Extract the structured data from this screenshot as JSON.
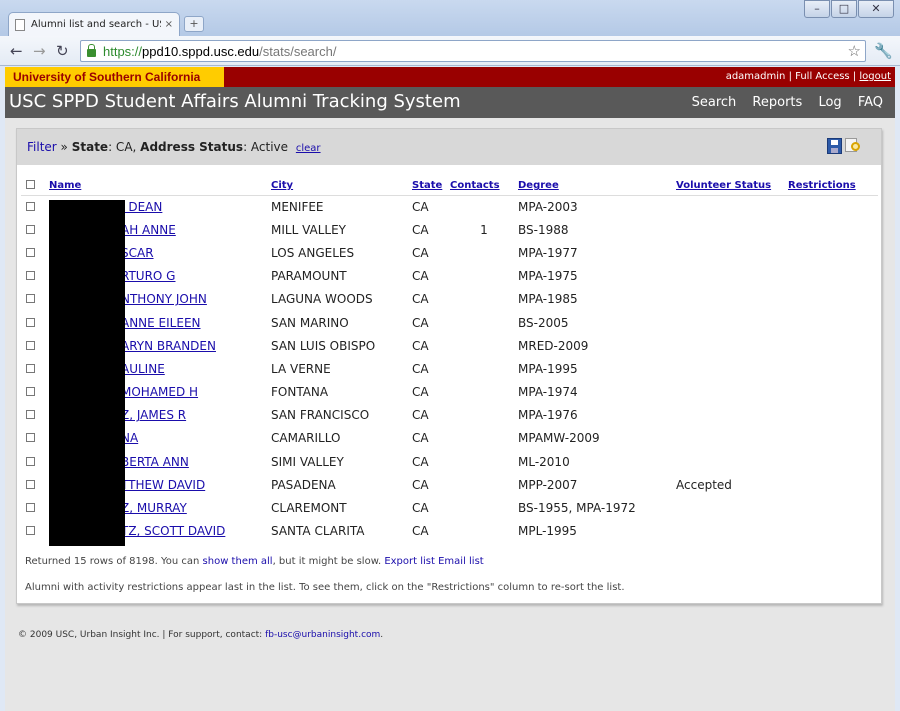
{
  "browser": {
    "tab_title": "Alumni list and search - US...",
    "tab_close": "×",
    "newtab": "+",
    "url_scheme": "https://",
    "url_host": "ppd10.sppd.usc.edu",
    "url_path": "/stats/search/",
    "back": "←",
    "forward": "→",
    "reload": "↻",
    "star": "☆",
    "wrench": "🔧",
    "minimize": "–",
    "maximize": "□",
    "close": "✕"
  },
  "header": {
    "university": "University of Southern California",
    "username": "adamadmin",
    "access": "Full Access",
    "logout": "logout",
    "sep": " | ",
    "site_title": "USC SPPD Student Affairs Alumni Tracking System",
    "nav": [
      "Search",
      "Reports",
      "Log",
      "FAQ"
    ]
  },
  "filter": {
    "filter_link": "Filter",
    "arrow": "»",
    "state_label": "State",
    "state_value": ": CA,",
    "address_label": "Address Status",
    "address_value": ": Active",
    "clear": "clear"
  },
  "table": {
    "columns": [
      "Name",
      "City",
      "State",
      "Contacts",
      "Degree",
      "Volunteer Status",
      "Restrictions"
    ],
    "rows": [
      {
        "name": "J DEAN",
        "city": "MENIFEE",
        "state": "CA",
        "contacts": "",
        "degree": "MPA-2003",
        "volunteer": "",
        "restrictions": ""
      },
      {
        "name": "AH ANNE",
        "city": "MILL VALLEY",
        "state": "CA",
        "contacts": "1",
        "degree": "BS-1988",
        "volunteer": "",
        "restrictions": ""
      },
      {
        "name": "SCAR",
        "city": "LOS ANGELES",
        "state": "CA",
        "contacts": "",
        "degree": "MPA-1977",
        "volunteer": "",
        "restrictions": ""
      },
      {
        "name": "RTURO G",
        "city": "PARAMOUNT",
        "state": "CA",
        "contacts": "",
        "degree": "MPA-1975",
        "volunteer": "",
        "restrictions": ""
      },
      {
        "name": "NTHONY JOHN",
        "city": "LAGUNA WOODS",
        "state": "CA",
        "contacts": "",
        "degree": "MPA-1985",
        "volunteer": "",
        "restrictions": ""
      },
      {
        "name": "ANNE EILEEN",
        "city": "SAN MARINO",
        "state": "CA",
        "contacts": "",
        "degree": "BS-2005",
        "volunteer": "",
        "restrictions": ""
      },
      {
        "name": "ARYN BRANDEN",
        "city": "SAN LUIS OBISPO",
        "state": "CA",
        "contacts": "",
        "degree": "MRED-2009",
        "volunteer": "",
        "restrictions": ""
      },
      {
        "name": "AULINE",
        "city": "LA VERNE",
        "state": "CA",
        "contacts": "",
        "degree": "MPA-1995",
        "volunteer": "",
        "restrictions": ""
      },
      {
        "name": "MOHAMED H",
        "city": "FONTANA",
        "state": "CA",
        "contacts": "",
        "degree": "MPA-1974",
        "volunteer": "",
        "restrictions": ""
      },
      {
        "name": "Z, JAMES R",
        "city": "SAN FRANCISCO",
        "state": "CA",
        "contacts": "",
        "degree": "MPA-1976",
        "volunteer": "",
        "restrictions": ""
      },
      {
        "name": "NA",
        "city": "CAMARILLO",
        "state": "CA",
        "contacts": "",
        "degree": "MPAMW-2009",
        "volunteer": "",
        "restrictions": ""
      },
      {
        "name": "BERTA ANN",
        "city": "SIMI VALLEY",
        "state": "CA",
        "contacts": "",
        "degree": "ML-2010",
        "volunteer": "",
        "restrictions": ""
      },
      {
        "name": "TTHEW DAVID",
        "city": "PASADENA",
        "state": "CA",
        "contacts": "",
        "degree": "MPP-2007",
        "volunteer": "Accepted",
        "restrictions": ""
      },
      {
        "name": "Z, MURRAY",
        "city": "CLAREMONT",
        "state": "CA",
        "contacts": "",
        "degree": "BS-1955, MPA-1972",
        "volunteer": "",
        "restrictions": ""
      },
      {
        "name": "TZ, SCOTT DAVID",
        "city": "SANTA CLARITA",
        "state": "CA",
        "contacts": "",
        "degree": "MPL-1995",
        "volunteer": "",
        "restrictions": ""
      }
    ]
  },
  "results": {
    "text1": "Returned 15 rows of 8198. You can ",
    "show_all": "show them all",
    "text2": ", but it might be slow. ",
    "export": "Export list",
    "email": "Email list",
    "note": "Alumni with activity restrictions appear last in the list. To see them, click on the \"Restrictions\" column to re-sort the list."
  },
  "footer": {
    "text": "© 2009 USC, Urban Insight Inc. | For support, contact: ",
    "email": "fb-usc@urbaninsight.com",
    "period": "."
  }
}
